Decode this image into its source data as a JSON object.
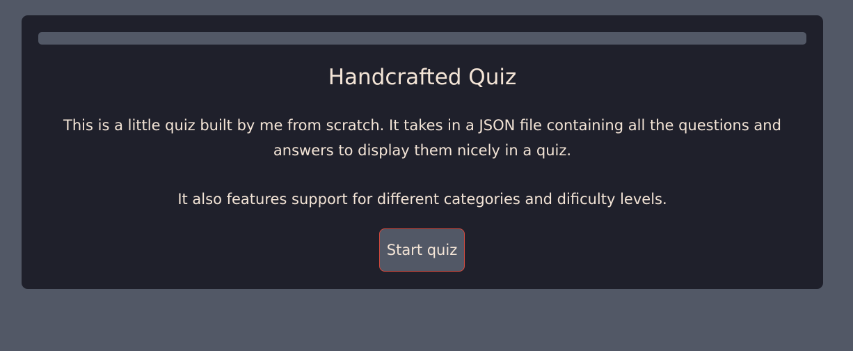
{
  "quiz": {
    "progress_percent": 0,
    "title": "Handcrafted Quiz",
    "description": "This is a little quiz built by me from scratch. It takes in a JSON file containing all the questions and answers to display them nicely in a quiz.",
    "description_extra": "It also features support for different categories and dificulty levels.",
    "start_label": "Start quiz"
  },
  "colors": {
    "page_background": "#525866",
    "card_background": "#1f202b",
    "text": "#f3e4d6",
    "button_border": "#d24a3e"
  }
}
